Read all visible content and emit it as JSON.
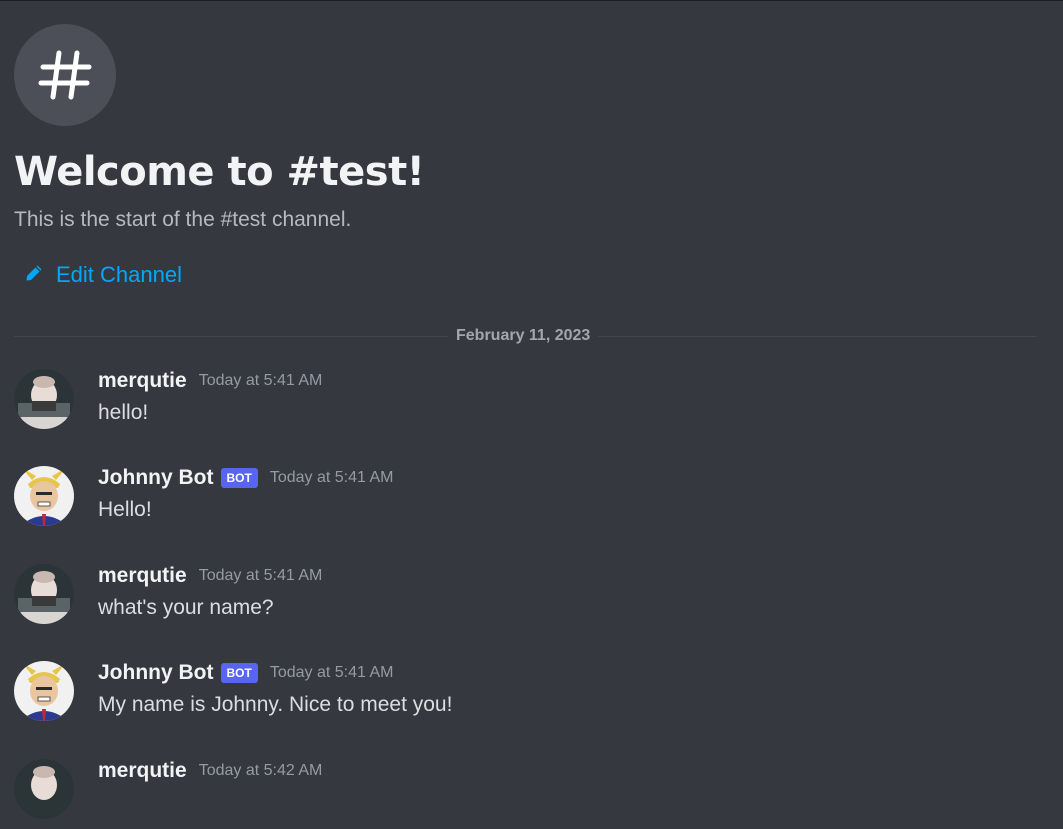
{
  "welcome": {
    "title": "Welcome to #test!",
    "subtitle": "This is the start of the #test channel.",
    "edit_label": "Edit Channel",
    "icon": "hash-icon"
  },
  "divider": {
    "date": "February 11, 2023"
  },
  "colors": {
    "background": "#36383f",
    "link": "#00a8fc",
    "bot_tag": "#5865f2"
  },
  "messages": [
    {
      "username": "merqutie",
      "bot": false,
      "timestamp": "Today at 5:41 AM",
      "text": "hello!"
    },
    {
      "username": "Johnny Bot",
      "bot": true,
      "bot_label": "BOT",
      "timestamp": "Today at 5:41 AM",
      "text": "Hello!"
    },
    {
      "username": "merqutie",
      "bot": false,
      "timestamp": "Today at 5:41 AM",
      "text": "what's your name?"
    },
    {
      "username": "Johnny Bot",
      "bot": true,
      "bot_label": "BOT",
      "timestamp": "Today at 5:41 AM",
      "text": "My name is Johnny. Nice to meet you!"
    },
    {
      "username": "merqutie",
      "bot": false,
      "timestamp": "Today at 5:42 AM",
      "text": ""
    }
  ]
}
